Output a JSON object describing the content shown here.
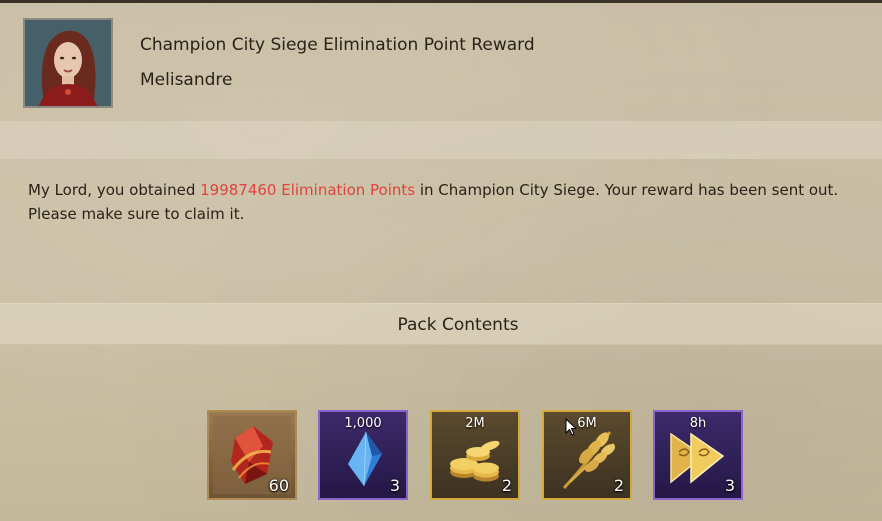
{
  "mail": {
    "title": "Champion City Siege Elimination Point Reward",
    "sender": "Melisandre",
    "message_pre": "My Lord, you obtained ",
    "message_highlight": "19987460 Elimination Points",
    "message_post": " in Champion City Siege. Your reward has been sent out. Please make sure to claim it."
  },
  "pack": {
    "title": "Pack Contents",
    "items": [
      {
        "name": "red-gem-item",
        "label": "",
        "count": "60",
        "frame": "brown"
      },
      {
        "name": "blue-crystal-item",
        "label": "1,000",
        "count": "3",
        "frame": "purple"
      },
      {
        "name": "gold-coins-item",
        "label": "2M",
        "count": "2",
        "frame": "gold"
      },
      {
        "name": "wheat-item",
        "label": "6M",
        "count": "2",
        "frame": "gold"
      },
      {
        "name": "speedup-item",
        "label": "8h",
        "count": "3",
        "frame": "purple"
      }
    ]
  },
  "colors": {
    "highlight": "#e0433d",
    "background": "#cbbfa4",
    "frame_gold": "#d6a83a",
    "frame_purple": "#8b63c9"
  }
}
